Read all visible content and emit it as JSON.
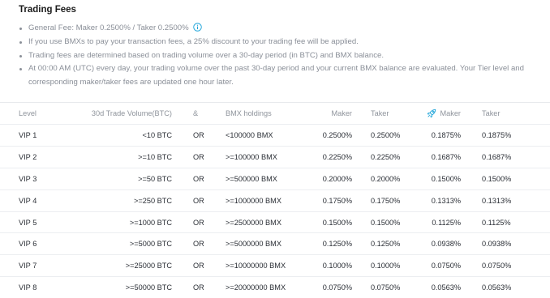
{
  "section": {
    "title": "Trading Fees",
    "notes": [
      "General Fee: Maker 0.2500% / Taker 0.2500%",
      "If you use BMXs to pay your transaction fees, a 25% discount to your trading fee will be applied.",
      "Trading fees are determined based on trading volume over a 30-day period (in BTC) and BMX balance.",
      "At 00:00 AM (UTC) every day, your trading volume over the past 30-day period and your current BMX balance are evaluated. Your Tier level and corresponding maker/taker fees are updated one hour later."
    ]
  },
  "colors": {
    "accent": "#1aa3d9",
    "text": "#2b2f36",
    "muted": "#8a8f98"
  },
  "icons": {
    "info": "info-circle-icon",
    "discount": "rocket-icon"
  },
  "table": {
    "headers": {
      "level": "Level",
      "volume": "30d Trade Volume(BTC)",
      "and": "&",
      "bmx": "BMX holdings",
      "maker": "Maker",
      "taker": "Taker",
      "discount_maker": "Maker",
      "discount_taker": "Taker"
    },
    "rows": [
      {
        "level": "VIP 1",
        "volume": "<10 BTC",
        "op": "OR",
        "bmx": "<100000 BMX",
        "maker": "0.2500%",
        "taker": "0.2500%",
        "dmaker": "0.1875%",
        "dtaker": "0.1875%"
      },
      {
        "level": "VIP 2",
        "volume": ">=10 BTC",
        "op": "OR",
        "bmx": ">=100000 BMX",
        "maker": "0.2250%",
        "taker": "0.2250%",
        "dmaker": "0.1687%",
        "dtaker": "0.1687%"
      },
      {
        "level": "VIP 3",
        "volume": ">=50 BTC",
        "op": "OR",
        "bmx": ">=500000 BMX",
        "maker": "0.2000%",
        "taker": "0.2000%",
        "dmaker": "0.1500%",
        "dtaker": "0.1500%"
      },
      {
        "level": "VIP 4",
        "volume": ">=250 BTC",
        "op": "OR",
        "bmx": ">=1000000 BMX",
        "maker": "0.1750%",
        "taker": "0.1750%",
        "dmaker": "0.1313%",
        "dtaker": "0.1313%"
      },
      {
        "level": "VIP 5",
        "volume": ">=1000 BTC",
        "op": "OR",
        "bmx": ">=2500000 BMX",
        "maker": "0.1500%",
        "taker": "0.1500%",
        "dmaker": "0.1125%",
        "dtaker": "0.1125%"
      },
      {
        "level": "VIP 6",
        "volume": ">=5000 BTC",
        "op": "OR",
        "bmx": ">=5000000 BMX",
        "maker": "0.1250%",
        "taker": "0.1250%",
        "dmaker": "0.0938%",
        "dtaker": "0.0938%"
      },
      {
        "level": "VIP 7",
        "volume": ">=25000 BTC",
        "op": "OR",
        "bmx": ">=10000000 BMX",
        "maker": "0.1000%",
        "taker": "0.1000%",
        "dmaker": "0.0750%",
        "dtaker": "0.0750%"
      },
      {
        "level": "VIP 8",
        "volume": ">=50000 BTC",
        "op": "OR",
        "bmx": ">=20000000 BMX",
        "maker": "0.0750%",
        "taker": "0.0750%",
        "dmaker": "0.0563%",
        "dtaker": "0.0563%"
      }
    ]
  }
}
